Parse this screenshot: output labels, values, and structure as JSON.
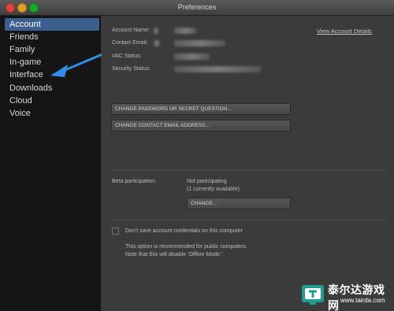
{
  "window": {
    "title": "Preferences"
  },
  "sidebar": {
    "items": [
      {
        "label": "Account",
        "active": true
      },
      {
        "label": "Friends"
      },
      {
        "label": "Family"
      },
      {
        "label": "In-game"
      },
      {
        "label": "Interface"
      },
      {
        "label": "Downloads"
      },
      {
        "label": "Cloud"
      },
      {
        "label": "Voice"
      }
    ]
  },
  "account": {
    "name_label": "Account Name:",
    "email_label": "Contact Email:",
    "vac_label": "VAC Status:",
    "security_label": "Security Status:",
    "view_details_link": "View Account Details",
    "change_password_button": "CHANGE PASSWORD OR SECRET QUESTION...",
    "change_email_button": "CHANGE CONTACT EMAIL ADDRESS..."
  },
  "beta": {
    "label": "Beta participation:",
    "status": "Not participating",
    "available": "(1 currently available)",
    "change_button": "CHANGE..."
  },
  "credentials": {
    "checkbox_label": "Don't save account credentials on this computer",
    "note_line1": "This option is recommended for public computers.",
    "note_line2": "Note that this will disable 'Offline Mode.'"
  },
  "watermark": {
    "title": "泰尔达游戏网",
    "url": "www.tairda.com"
  },
  "colors": {
    "accent": "#3c5f8f",
    "arrow": "#2f8ee6"
  }
}
